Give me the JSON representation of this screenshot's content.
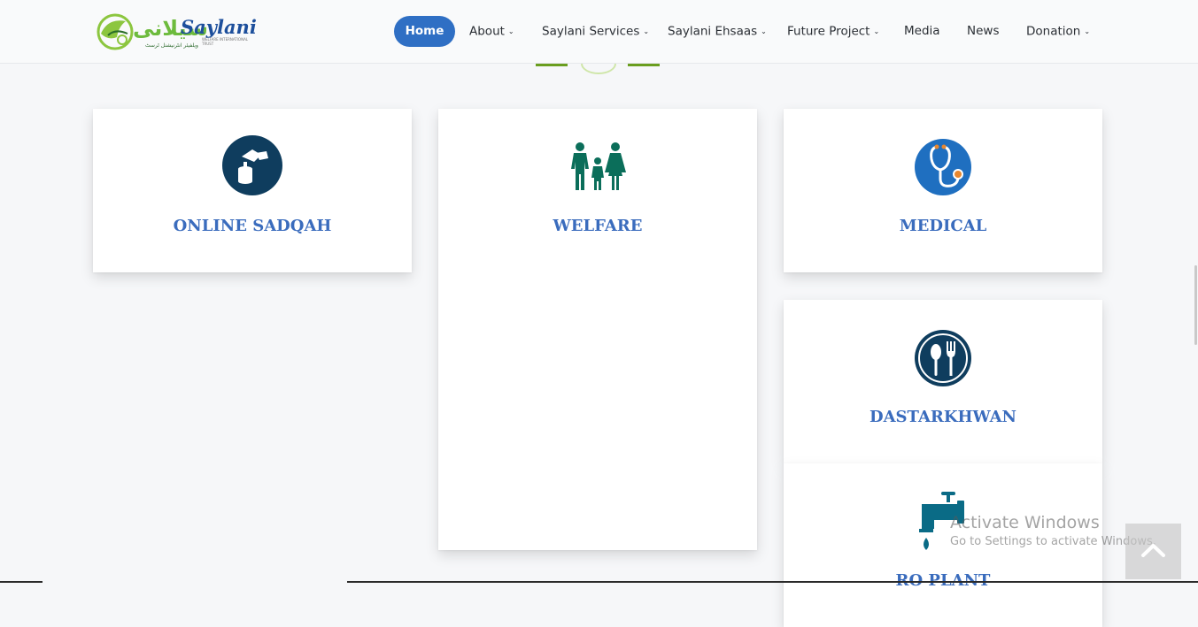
{
  "logo": {
    "urdu_text": "سیلانی",
    "latin_text": "Saylani",
    "tagline_urdu": "ویلفیئر انٹرنیشنل ٹرسٹ",
    "tagline_en": "WELFARE INTERNATIONAL TRUST"
  },
  "nav": {
    "items": [
      {
        "label": "Home",
        "active": true
      },
      {
        "label": "About",
        "has_dropdown": true
      },
      {
        "label": "Saylani Services",
        "has_dropdown": true
      },
      {
        "label": "Saylani Ehsaas",
        "has_dropdown": true
      },
      {
        "label": "Future Project",
        "has_dropdown": true
      },
      {
        "label": "Media"
      },
      {
        "label": "News"
      },
      {
        "label": "Donation",
        "has_dropdown": true
      }
    ]
  },
  "services": [
    {
      "title": "ONLINE SADQAH",
      "icon": "sadqah-donation-icon"
    },
    {
      "title": "WELFARE",
      "icon": "family-icon"
    },
    {
      "title": "MEDICAL",
      "icon": "stethoscope-icon"
    },
    {
      "title": "DASTARKHWAN",
      "icon": "spoon-fork-icon"
    },
    {
      "title": "RO PLANT",
      "icon": "water-tap-icon"
    }
  ],
  "watermark": {
    "title": "Activate Windows",
    "subtitle": "Go to Settings to activate Windows."
  },
  "colors": {
    "accent": "#2f6fc4",
    "title_blue": "#3a6cbd",
    "icon_navy": "#0f3d5e",
    "icon_teal": "#0b6e5a",
    "divider_green": "#6a9e1f",
    "logo_green": "#6dbb3d",
    "logo_blue": "#1d4f9c"
  }
}
